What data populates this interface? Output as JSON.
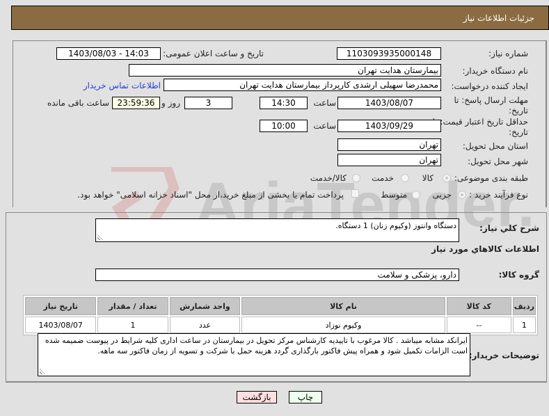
{
  "header": {
    "title": "جزئیات اطلاعات نیاز"
  },
  "fields": {
    "need_number_label": "شماره نیاز:",
    "need_number": "1103093935000148",
    "announce_label": "تاریخ و ساعت اعلان عمومی:",
    "announce_value": "1403/08/03 - 14:03",
    "buyer_org_label": "نام دستگاه خریدار:",
    "buyer_org": "بیمارستان هدایت تهران",
    "creator_label": "ایجاد کننده درخواست:",
    "creator": "محمدرضا سهیلی ارشدی کارپرداز بیمارستان هدایت تهران",
    "buyer_contact_link": "اطلاعات تماس خریدار",
    "reply_deadline_label": "مهلت ارسال پاسخ: تا تاریخ:",
    "reply_date": "1403/08/07",
    "time_label": "ساعت",
    "reply_time": "14:30",
    "days_value": "3",
    "days_label": "روز و",
    "remaining_time": "23:59:36",
    "remaining_label": "ساعت باقی مانده",
    "price_validity_label": "حداقل تاریخ اعتبار قیمت: تا تاریخ:",
    "price_validity_date": "1403/09/29",
    "price_validity_time": "10:00",
    "province_label": "استان محل تحویل:",
    "province": "تهران",
    "city_label": "شهر محل تحویل:",
    "city": "تهران",
    "category_label": "طبقه بندی موضوعی:",
    "category_options": [
      "کالا",
      "خدمت",
      "کالا/خدمت"
    ],
    "category_selected": "کالا",
    "process_label": "نوع فرآیند خرید :",
    "process_options": [
      "جزیی",
      "متوسط"
    ],
    "process_selected": "جزیی",
    "treasury_checkbox_label": "پرداخت تمام یا بخشی از مبلغ خرید،از محل \"اسناد خزانه اسلامی\" خواهد بود."
  },
  "details": {
    "general_desc_label": "شرح کلي نياز:",
    "general_desc": "دستگاه وانتوز (وکیوم زنان) 1 دستگاه.",
    "items_section_title": "اطلاعات کالاهاي مورد نياز",
    "goods_group_label": "گروه کالا:",
    "goods_group": "دارو، پزشکی و سلامت",
    "table": {
      "headers": [
        "ردیف",
        "کد کالا",
        "نام کالا",
        "واحد شمارش",
        "تعداد / مقدار",
        "تاریخ نیاز"
      ],
      "rows": [
        [
          "1",
          "--",
          "وکیوم نوزاد",
          "عدد",
          "1",
          "1403/08/07"
        ]
      ]
    },
    "buyer_notes_label": "توضیحات خریدار:",
    "buyer_notes": "ایرانکد مشابه میباشد . کالا مرغوب با تاییدیه کارشناس مرکز تحویل در بیمارستان در ساعت اداری کلیه شرایط در پیوست ضمیمه شده است الزامات تکمیل شود و همراه پیش فاکتور بارگذاری گردد هزینه حمل با شرکت و تسویه از زمان فاکتور سه ماهه."
  },
  "buttons": {
    "print": "چاپ",
    "back": "بازگشت"
  },
  "watermark": {
    "text": "AriaTender.net"
  },
  "colors": {
    "header_bg": "#8b6c42",
    "link": "#2a3fcf",
    "print_bg": "#efffef",
    "back_bg": "#ffe0e0"
  }
}
